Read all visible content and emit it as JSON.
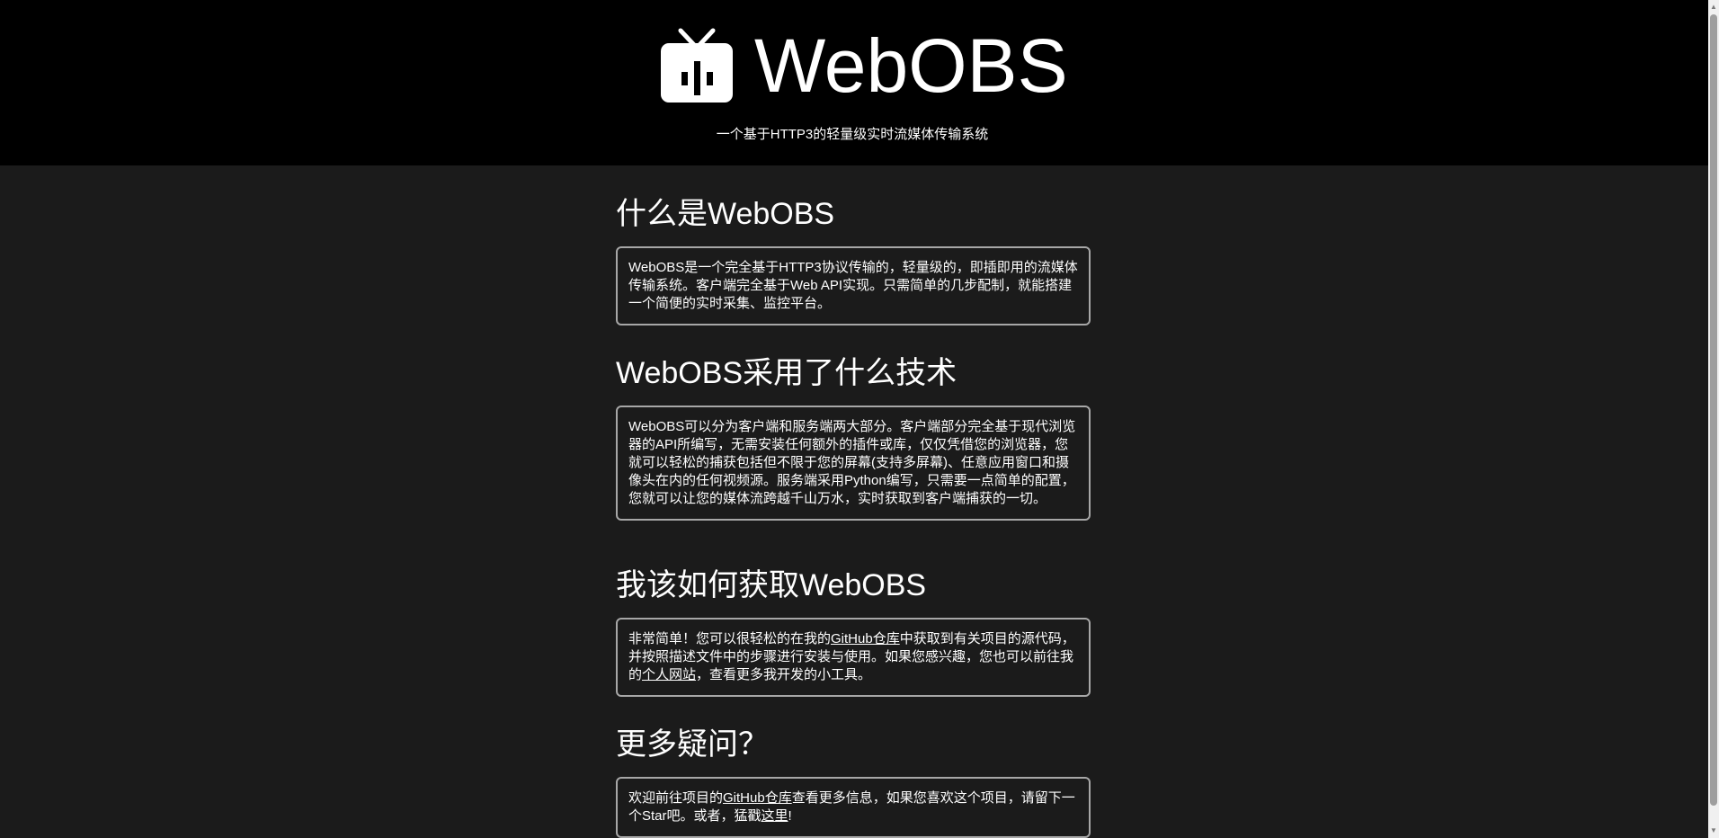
{
  "header": {
    "logo_icon": "tv-icon",
    "brand": "WebOBS",
    "tagline": "一个基于HTTP3的轻量级实时流媒体传输系统"
  },
  "sections": [
    {
      "heading": "什么是WebOBS",
      "body": "WebOBS是一个完全基于HTTP3协议传输的，轻量级的，即插即用的流媒体传输系统。客户端完全基于Web API实现。只需简单的几步配制，就能搭建一个简便的实时采集、监控平台。"
    },
    {
      "heading": "WebOBS采用了什么技术",
      "body": "WebOBS可以分为客户端和服务端两大部分。客户端部分完全基于现代浏览器的API所编写，无需安装任何额外的插件或库，仅仅凭借您的浏览器，您就可以轻松的捕获包括但不限于您的屏幕(支持多屏幕)、任意应用窗口和摄像头在内的任何视频源。服务端采用Python编写，只需要一点简单的配置，您就可以让您的媒体流跨越千山万水，实时获取到客户端捕获的一切。"
    },
    {
      "heading": "我该如何获取WebOBS",
      "body_part1": "非常简单！您可以很轻松的在我的",
      "link1": "GitHub仓库",
      "body_part2": "中获取到有关项目的源代码，并按照描述文件中的步骤进行安装与使用。如果您感兴趣，您也可以前往我的",
      "link2": "个人网站",
      "body_part3": "，查看更多我开发的小工具。"
    },
    {
      "heading": "更多疑问？",
      "body_part1": "欢迎前往项目的",
      "link1": "GitHub仓库",
      "body_part2": "查看更多信息，如果您喜欢这个项目，请留下一个Star吧。或者，猛戳",
      "link2": "这里",
      "body_part3": "!"
    }
  ],
  "scrollbar": {
    "up_icon": "scroll-up-arrow-icon",
    "down_icon": "scroll-down-arrow-icon"
  }
}
